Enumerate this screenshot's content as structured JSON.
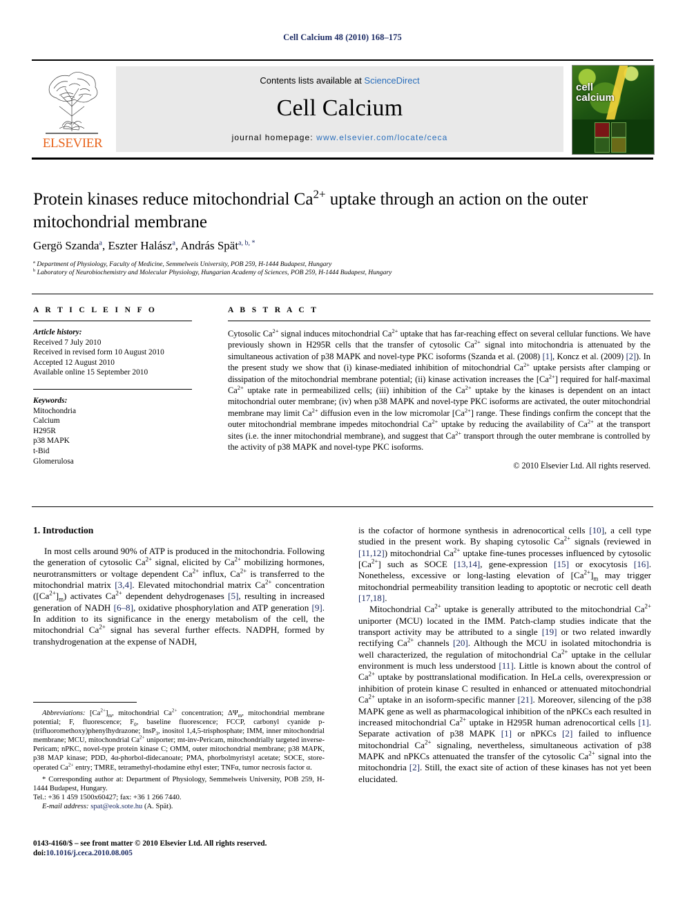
{
  "running_head": "Cell Calcium 48 (2010) 168–175",
  "masthead": {
    "contents_prefix": "Contents lists available at ",
    "sciencedirect": "ScienceDirect",
    "journal_title": "Cell Calcium",
    "homepage_prefix": "journal homepage: ",
    "homepage_url": "www.elsevier.com/locate/ceca",
    "publisher": "ELSEVIER",
    "cover_word_line1": "cell",
    "cover_word_line2": "calcium",
    "link_color": "#2a6ebb",
    "publisher_color": "#E8641C"
  },
  "article": {
    "title_part1": "Protein kinases reduce mitochondrial Ca",
    "title_sup": "2+",
    "title_part2": " uptake through an action on the outer mitochondrial membrane",
    "authors": [
      {
        "name": "Gergö Szanda",
        "marks": "a"
      },
      {
        "name": "Eszter Halász",
        "marks": "a"
      },
      {
        "name": "András Spät",
        "marks": "a, b, *"
      }
    ],
    "authors_line": "Gergö Szanda a, Eszter Halász a, András Spät a, b, *",
    "affiliations": [
      {
        "mark": "a",
        "text": "Department of Physiology, Faculty of Medicine, Semmelweis University, POB 259, H-1444 Budapest, Hungary"
      },
      {
        "mark": "b",
        "text": "Laboratory of Neurobiochemistry and Molecular Physiology, Hungarian Academy of Sciences, POB 259, H-1444 Budapest, Hungary"
      }
    ]
  },
  "article_info": {
    "heading": "A R T I C L E   I N F O",
    "history_label": "Article history:",
    "history": [
      "Received 7 July 2010",
      "Received in revised form 10 August 2010",
      "Accepted 12 August 2010",
      "Available online 15 September 2010"
    ],
    "keywords_label": "Keywords:",
    "keywords": [
      "Mitochondria",
      "Calcium",
      "H295R",
      "p38 MAPK",
      "t-Bid",
      "Glomerulosa"
    ]
  },
  "abstract": {
    "heading": "A B S T R A C T",
    "copyright": "© 2010 Elsevier Ltd. All rights reserved.",
    "text_segments": [
      {
        "t": "Cytosolic Ca"
      },
      {
        "sup": "2+"
      },
      {
        "t": " signal induces mitochondrial Ca"
      },
      {
        "sup": "2+"
      },
      {
        "t": " uptake that has far-reaching effect on several cellular functions. We have previously shown in H295R cells that the transfer of cytosolic Ca"
      },
      {
        "sup": "2+"
      },
      {
        "t": " signal into mitochondria is attenuated by the simultaneous activation of p38 MAPK and novel-type PKC isoforms (Szanda et al. (2008) "
      },
      {
        "ref": "[1]"
      },
      {
        "t": ", Koncz et al. (2009) "
      },
      {
        "ref": "[2]"
      },
      {
        "t": "). In the present study we show that (i) kinase-mediated inhibition of mitochondrial Ca"
      },
      {
        "sup": "2+"
      },
      {
        "t": " uptake persists after clamping or dissipation of the mitochondrial membrane potential; (ii) kinase activation increases the [Ca"
      },
      {
        "sup": "2+"
      },
      {
        "t": "] required for half-maximal Ca"
      },
      {
        "sup": "2+"
      },
      {
        "t": " uptake rate in permeabilized cells; (iii) inhibition of the Ca"
      },
      {
        "sup": "2+"
      },
      {
        "t": " uptake by the kinases is dependent on an intact mitochondrial outer membrane; (iv) when p38 MAPK and novel-type PKC isoforms are activated, the outer mitochondrial membrane may limit Ca"
      },
      {
        "sup": "2+"
      },
      {
        "t": " diffusion even in the low micromolar [Ca"
      },
      {
        "sup": "2+"
      },
      {
        "t": "] range. These findings confirm the concept that the outer mitochondrial membrane impedes mitochondrial Ca"
      },
      {
        "sup": "2+"
      },
      {
        "t": " uptake by reducing the availability of Ca"
      },
      {
        "sup": "2+"
      },
      {
        "t": " at the transport sites (i.e. the inner mitochondrial membrane), and suggest that Ca"
      },
      {
        "sup": "2+"
      },
      {
        "t": " transport through the outer membrane is controlled by the activity of p38 MAPK and novel-type PKC isoforms."
      }
    ],
    "plain_text": "Cytosolic Ca2+ signal induces mitochondrial Ca2+ uptake that has far-reaching effect on several cellular functions. We have previously shown in H295R cells that the transfer of cytosolic Ca2+ signal into mitochondria is attenuated by the simultaneous activation of p38 MAPK and novel-type PKC isoforms (Szanda et al. (2008) [1], Koncz et al. (2009) [2]). In the present study we show that (i) kinase-mediated inhibition of mitochondrial Ca2+ uptake persists after clamping or dissipation of the mitochondrial membrane potential; (ii) kinase activation increases the [Ca2+] required for half-maximal Ca2+ uptake rate in permeabilized cells; (iii) inhibition of the Ca2+ uptake by the kinases is dependent on an intact mitochondrial outer membrane; (iv) when p38 MAPK and novel-type PKC isoforms are activated, the outer mitochondrial membrane may limit Ca2+ diffusion even in the low micromolar [Ca2+] range. These findings confirm the concept that the outer mitochondrial membrane impedes mitochondrial Ca2+ uptake by reducing the availability of Ca2+ at the transport sites (i.e. the inner mitochondrial membrane), and suggest that Ca2+ transport through the outer membrane is controlled by the activity of p38 MAPK and novel-type PKC isoforms."
  },
  "introduction": {
    "heading": "1. Introduction",
    "left_paragraph": "In most cells around 90% of ATP is produced in the mitochondria. Following the generation of cytosolic Ca2+ signal, elicited by Ca2+ mobilizing hormones, neurotransmitters or voltage dependent Ca2+ influx, Ca2+ is transferred to the mitochondrial matrix [3,4]. Elevated mitochondrial matrix Ca2+ concentration ([Ca2+]m) activates Ca2+ dependent dehydrogenases [5], resulting in increased generation of NADH [6–8], oxidative phosphorylation and ATP generation [9]. In addition to its significance in the energy metabolism of the cell, the mitochondrial Ca2+ signal has several further effects. NADPH, formed by transhydrogenation at the expense of NADH,",
    "right_paragraph_1": "is the cofactor of hormone synthesis in adrenocortical cells [10], a cell type studied in the present work. By shaping cytosolic Ca2+ signals (reviewed in [11,12]) mitochondrial Ca2+ uptake fine-tunes processes influenced by cytosolic [Ca2+] such as SOCE [13,14], gene-expression [15] or exocytosis [16]. Nonetheless, excessive or long-lasting elevation of [Ca2+]m may trigger mitochondrial permeability transition leading to apoptotic or necrotic cell death [17,18].",
    "right_paragraph_2": "Mitochondrial Ca2+ uptake is generally attributed to the mitochondrial Ca2+ uniporter (MCU) located in the IMM. Patch-clamp studies indicate that the transport activity may be attributed to a single [19] or two related inwardly rectifying Ca2+ channels [20]. Although the MCU in isolated mitochondria is well characterized, the regulation of mitochondrial Ca2+ uptake in the cellular environment is much less understood [11]. Little is known about the control of Ca2+ uptake by posttranslational modification. In HeLa cells, overexpression or inhibition of protein kinase C resulted in enhanced or attenuated mitochondrial Ca2+ uptake in an isoform-specific manner [21]. Moreover, silencing of the p38 MAPK gene as well as pharmacological inhibition of the nPKCs each resulted in increased mitochondrial Ca2+ uptake in H295R human adrenocortical cells [1]. Separate activation of p38 MAPK [1] or nPKCs [2] failed to influence mitochondrial Ca2+ signaling, nevertheless, simultaneous activation of p38 MAPK and nPKCs attenuated the transfer of the cytosolic Ca2+ signal into the mitochondria [2]. Still, the exact site of action of these kinases has not yet been elucidated."
  },
  "footnotes": {
    "abbreviations_label": "Abbreviations:",
    "abbreviations_text": "[Ca2+]m, mitochondrial Ca2+ concentration; ΔΨm, mitochondrial membrane potential; F, fluorescence; F0, baseline fluorescence; FCCP, carbonyl cyanide p-(trifluoromethoxy)phenylhydrazone; InsP3, inositol 1,4,5-trisphosphate; IMM, inner mitochondrial membrane; MCU, mitochondrial Ca2+ uniporter; mt-inv-Pericam, mitochondrially targeted inverse-Pericam; nPKC, novel-type protein kinase C; OMM, outer mitochondrial membrane; p38 MAPK, p38 MAP kinase; PDD, 4α-phorbol-didecanoate; PMA, phorbolmyristyl acetate; SOCE, store-operated Ca2+ entry; TMRE, tetramethyl-rhodamine ethyl ester; TNFα, tumor necrosis factor α.",
    "corresponding_marker": "*",
    "corresponding_text": "Corresponding author at: Department of Physiology, Semmelweis University, POB 259, H-1444 Budapest, Hungary.",
    "tel_fax": "Tel.: +36 1 459 1500x60427; fax: +36 1 266 7440.",
    "email_label": "E-mail address:",
    "email": "spat@eok.sote.hu",
    "email_owner": "(A. Spät)."
  },
  "footer": {
    "issn_line": "0143-4160/$ – see front matter © 2010 Elsevier Ltd. All rights reserved.",
    "doi_label": "doi:",
    "doi": "10.1016/j.ceca.2010.08.005"
  }
}
